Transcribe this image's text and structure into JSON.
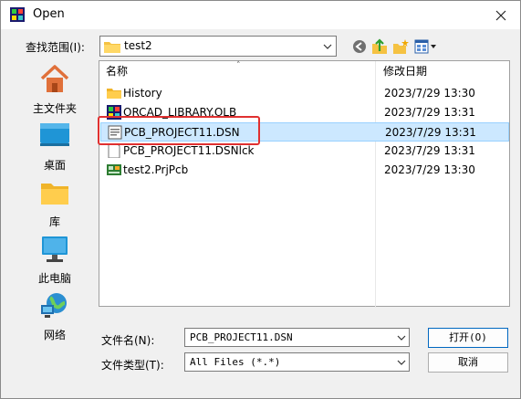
{
  "window": {
    "title": "Open",
    "close_icon": "close-icon"
  },
  "toolbar": {
    "lookin_label": "查找范围(I):",
    "lookin_value": "test2",
    "icons": [
      "back-icon",
      "up-folder-icon",
      "new-folder-icon",
      "view-menu-icon"
    ]
  },
  "places": [
    {
      "label": "主文件夹",
      "icon": "home-icon"
    },
    {
      "label": "桌面",
      "icon": "desktop-icon"
    },
    {
      "label": "库",
      "icon": "library-folder-icon"
    },
    {
      "label": "此电脑",
      "icon": "computer-icon"
    },
    {
      "label": "网络",
      "icon": "network-icon"
    }
  ],
  "filelist": {
    "columns": {
      "name": "名称",
      "date": "修改日期"
    },
    "rows": [
      {
        "name": "History",
        "date": "2023/7/29 13:30",
        "icon": "folder-icon",
        "selected": false
      },
      {
        "name": "ORCAD_LIBRARY.OLB",
        "date": "2023/7/29 13:31",
        "icon": "olb-file-icon",
        "selected": false
      },
      {
        "name": "PCB_PROJECT11.DSN",
        "date": "2023/7/29 13:31",
        "icon": "dsn-file-icon",
        "selected": true
      },
      {
        "name": "PCB_PROJECT11.DSNlck",
        "date": "2023/7/29 13:31",
        "icon": "file-icon",
        "selected": false
      },
      {
        "name": "test2.PrjPcb",
        "date": "2023/7/29 13:30",
        "icon": "prjpcb-file-icon",
        "selected": false
      }
    ]
  },
  "form": {
    "filename_label": "文件名(N):",
    "filename_value": "PCB_PROJECT11.DSN",
    "filetype_label": "文件类型(T):",
    "filetype_value": "All Files (*.*)",
    "open_label": "打开(O)",
    "cancel_label": "取消"
  },
  "colors": {
    "selection": "#cce8ff",
    "highlight_border": "#e03030",
    "accent": "#0067c0"
  }
}
